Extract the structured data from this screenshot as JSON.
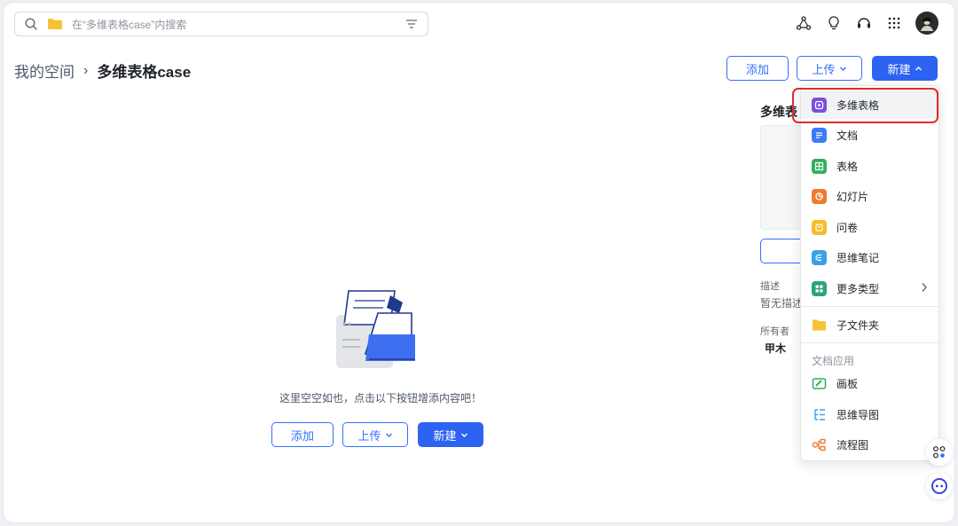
{
  "search": {
    "placeholder": "在“多维表格case”内搜索"
  },
  "breadcrumb": {
    "root": "我的空间",
    "separator": "›",
    "current": "多维表格case"
  },
  "header_actions": {
    "add": "添加",
    "upload": "上传",
    "new": "新建"
  },
  "empty_state": {
    "message": "这里空空如也，点击以下按钮增添内容吧！",
    "add": "添加",
    "upload": "上传",
    "new": "新建"
  },
  "side_panel": {
    "title": "多维表",
    "desc_label": "描述",
    "desc_value": "暂无描述",
    "owner_label": "所有者",
    "owner_value": "甲木"
  },
  "new_menu": {
    "items": [
      {
        "label": "多维表格",
        "icon": "bitable-icon",
        "color": "#7b4fe0"
      },
      {
        "label": "文档",
        "icon": "doc-icon",
        "color": "#3d7bf7"
      },
      {
        "label": "表格",
        "icon": "sheet-icon",
        "color": "#33b05a"
      },
      {
        "label": "幻灯片",
        "icon": "slides-icon",
        "color": "#f07a2f"
      },
      {
        "label": "问卷",
        "icon": "survey-icon",
        "color": "#f5bd2e"
      },
      {
        "label": "思维笔记",
        "icon": "mindnote-icon",
        "color": "#3aa0e8"
      },
      {
        "label": "更多类型",
        "icon": "more-types-icon",
        "color": "#2fa37c"
      },
      {
        "label": "子文件夹",
        "icon": "folder-icon",
        "color": "#f7c236"
      }
    ],
    "section_label": "文档应用",
    "apps": [
      {
        "label": "画板",
        "icon": "whiteboard-icon",
        "color": "#33b05a"
      },
      {
        "label": "思维导图",
        "icon": "mindmap-icon",
        "color": "#3aa0e8"
      },
      {
        "label": "流程图",
        "icon": "flowchart-icon",
        "color": "#f07a2f"
      }
    ]
  }
}
